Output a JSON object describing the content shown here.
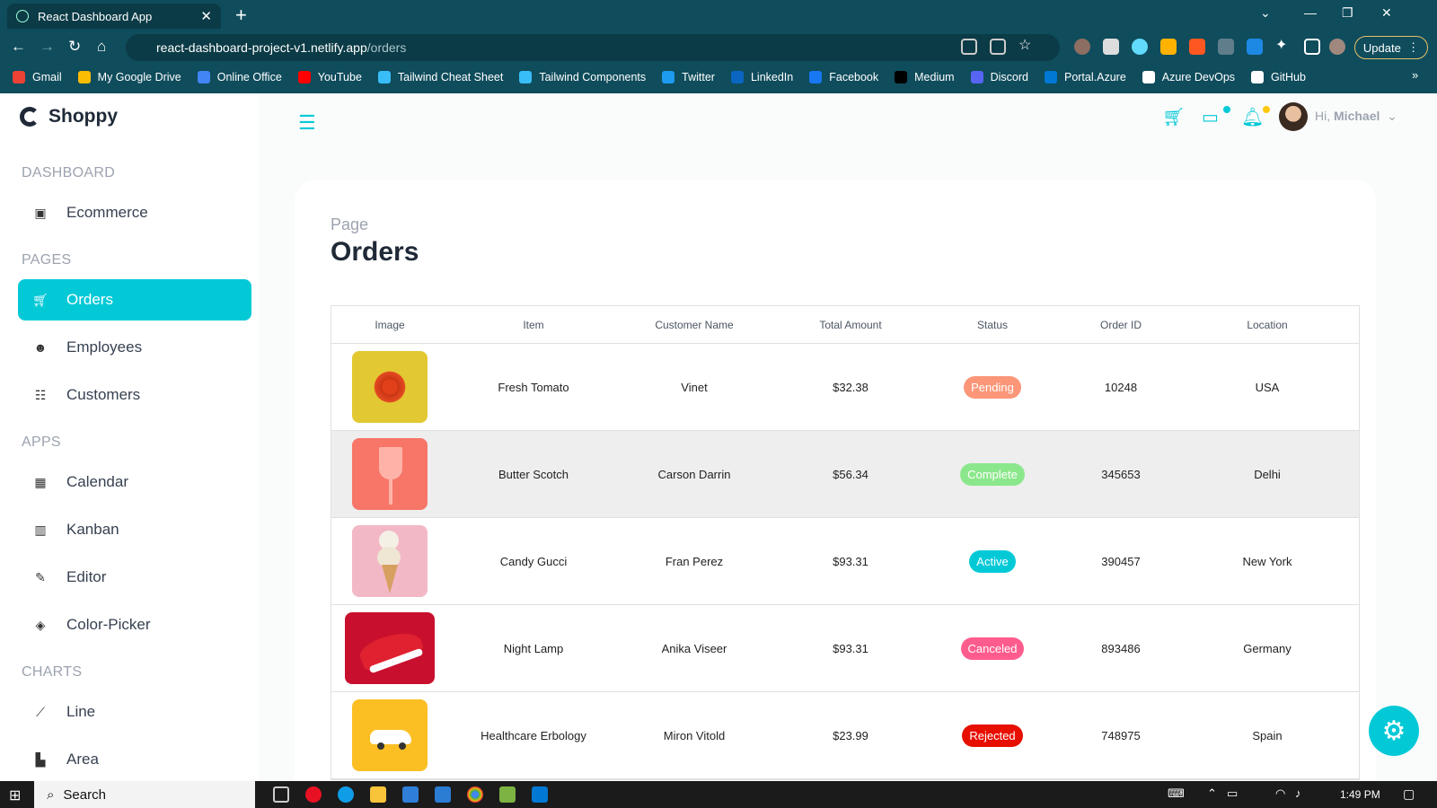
{
  "browser": {
    "tab_title": "React Dashboard App",
    "url_host": "react-dashboard-project-v1.netlify.app",
    "url_path": "/orders",
    "update_label": "Update",
    "bookmarks": [
      "Gmail",
      "My Google Drive",
      "Online Office",
      "YouTube",
      "Tailwind Cheat Sheet",
      "Tailwind Components",
      "Twitter",
      "LinkedIn",
      "Facebook",
      "Medium",
      "Discord",
      "Portal.Azure",
      "Azure DevOps",
      "GitHub"
    ],
    "bookmark_colors": [
      "#ea4335",
      "#fbbc04",
      "#4285f4",
      "#ff0000",
      "#38bdf8",
      "#38bdf8",
      "#1d9bf0",
      "#0a66c2",
      "#1877f2",
      "#000000",
      "#5865f2",
      "#0078d4",
      "#ffffff",
      "#ffffff"
    ]
  },
  "sidebar": {
    "brand": "Shoppy",
    "sections": [
      {
        "title": "DASHBOARD",
        "items": [
          {
            "label": "Ecommerce",
            "icon": "shopping-bag-icon"
          }
        ]
      },
      {
        "title": "PAGES",
        "items": [
          {
            "label": "Orders",
            "icon": "cart-icon",
            "active": true
          },
          {
            "label": "Employees",
            "icon": "employees-icon"
          },
          {
            "label": "Customers",
            "icon": "customers-icon"
          }
        ]
      },
      {
        "title": "APPS",
        "items": [
          {
            "label": "Calendar",
            "icon": "calendar-icon"
          },
          {
            "label": "Kanban",
            "icon": "kanban-icon"
          },
          {
            "label": "Editor",
            "icon": "editor-icon"
          },
          {
            "label": "Color-Picker",
            "icon": "color-picker-icon"
          }
        ]
      },
      {
        "title": "CHARTS",
        "items": [
          {
            "label": "Line",
            "icon": "line-chart-icon"
          },
          {
            "label": "Area",
            "icon": "area-chart-icon"
          }
        ]
      }
    ]
  },
  "header": {
    "greeting": "Hi,",
    "user_name": "Michael"
  },
  "page": {
    "subtitle": "Page",
    "title": "Orders"
  },
  "orders": {
    "columns": [
      "Image",
      "Item",
      "Customer Name",
      "Total Amount",
      "Status",
      "Order ID",
      "Location"
    ],
    "rows": [
      {
        "item": "Fresh Tomato",
        "customer": "Vinet",
        "amount": "$32.38",
        "status": "Pending",
        "status_color": "#fb9678",
        "order_id": "10248",
        "location": "USA",
        "image": "tomatoes",
        "image_bg": "#e2c832"
      },
      {
        "item": "Butter Scotch",
        "customer": "Carson Darrin",
        "amount": "$56.34",
        "status": "Complete",
        "status_color": "#8be78b",
        "order_id": "345653",
        "location": "Delhi",
        "image": "pink-glass",
        "image_bg": "#f77668"
      },
      {
        "item": "Candy Gucci",
        "customer": "Fran Perez",
        "amount": "$93.31",
        "status": "Active",
        "status_color": "#03c9d7",
        "order_id": "390457",
        "location": "New York",
        "image": "ice-cream",
        "image_bg": "#f2b8c6"
      },
      {
        "item": "Night Lamp",
        "customer": "Anika Viseer",
        "amount": "$93.31",
        "status": "Canceled",
        "status_color": "#ff5c8e",
        "order_id": "893486",
        "location": "Germany",
        "image": "red-sneaker",
        "image_bg": "#c8102e"
      },
      {
        "item": "Healthcare Erbology",
        "customer": "Miron Vitold",
        "amount": "$23.99",
        "status": "Rejected",
        "status_color": "#e70f00",
        "order_id": "748975",
        "location": "Spain",
        "image": "toy-car",
        "image_bg": "#fbbf24"
      }
    ]
  },
  "taskbar": {
    "search_label": "Search",
    "time": "1:49 PM"
  }
}
